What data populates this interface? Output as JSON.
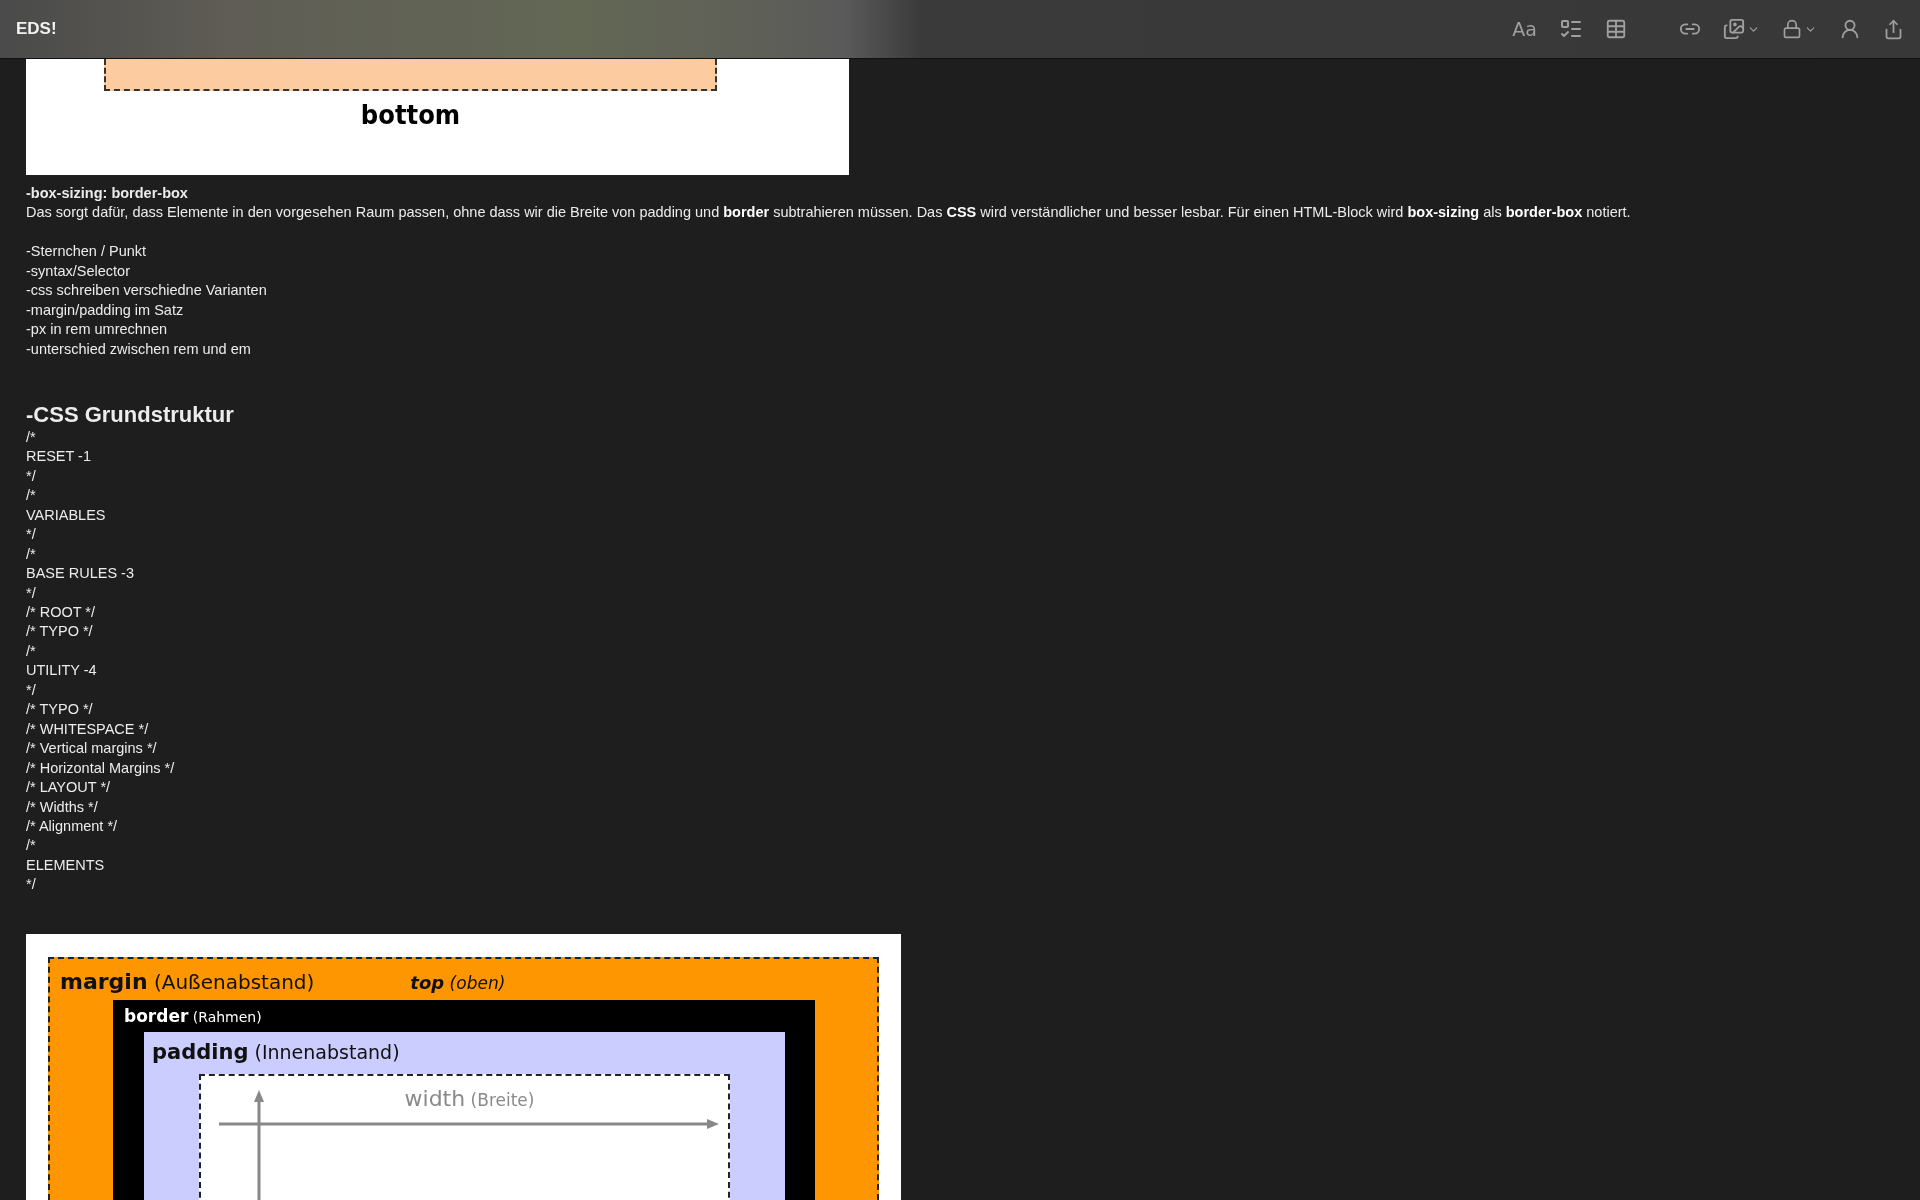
{
  "window": {
    "title": "EDS!"
  },
  "toolbar": {
    "format_label": "Aa"
  },
  "top_figure": {
    "label": "bottom"
  },
  "blocks": [
    {
      "kind": "bold",
      "text": "-box-sizing: border-box"
    },
    {
      "kind": "text",
      "text": "Das sorgt dafür, dass Elemente in den vorgesehen Raum passen, ohne dass wir die Breite von padding und **border** subtrahieren müssen. Das **CSS** wird verständlicher und besser lesbar. Für einen HTML-Block wird **box-sizing** als **border-box** notiert."
    },
    {
      "kind": "blank"
    },
    {
      "kind": "text",
      "text": "-Sternchen / Punkt"
    },
    {
      "kind": "text",
      "text": "-syntax/Selector"
    },
    {
      "kind": "text",
      "text": "-css schreiben verschiedne Varianten"
    },
    {
      "kind": "text",
      "text": "-margin/padding im Satz"
    },
    {
      "kind": "text",
      "text": "-px in rem umrechnen"
    },
    {
      "kind": "text",
      "text": "-unterschied zwischen rem und em"
    },
    {
      "kind": "blank"
    },
    {
      "kind": "blank"
    },
    {
      "kind": "heading",
      "text": "-CSS Grundstruktur"
    },
    {
      "kind": "text",
      "text": "/*"
    },
    {
      "kind": "text",
      "text": "RESET -1"
    },
    {
      "kind": "text",
      "text": "*/"
    },
    {
      "kind": "text",
      "text": "/*"
    },
    {
      "kind": "text",
      "text": "VARIABLES"
    },
    {
      "kind": "text",
      "text": "*/"
    },
    {
      "kind": "text",
      "text": "/*"
    },
    {
      "kind": "text",
      "text": "BASE RULES -3"
    },
    {
      "kind": "text",
      "text": "*/"
    },
    {
      "kind": "text",
      "text": "/* ROOT */"
    },
    {
      "kind": "text",
      "text": "/* TYPO */"
    },
    {
      "kind": "text",
      "text": "/*"
    },
    {
      "kind": "text",
      "text": "UTILITY -4"
    },
    {
      "kind": "text",
      "text": "*/"
    },
    {
      "kind": "text",
      "text": "/* TYPO */"
    },
    {
      "kind": "text",
      "text": "/* WHITESPACE */"
    },
    {
      "kind": "text",
      "text": "/* Vertical margins */"
    },
    {
      "kind": "text",
      "text": "/* Horizontal Margins */"
    },
    {
      "kind": "text",
      "text": "/* LAYOUT */"
    },
    {
      "kind": "text",
      "text": "/* Widths */"
    },
    {
      "kind": "text",
      "text": "/* Alignment */"
    },
    {
      "kind": "text",
      "text": "/*"
    },
    {
      "kind": "text",
      "text": "ELEMENTS"
    },
    {
      "kind": "text",
      "text": "*/"
    },
    {
      "kind": "blank"
    },
    {
      "kind": "blank"
    }
  ],
  "box_model_figure": {
    "margin": {
      "term": "margin",
      "gloss": "(Außenabstand)"
    },
    "top": {
      "term": "top",
      "gloss": "(oben)"
    },
    "border": {
      "term": "border",
      "gloss": "(Rahmen)"
    },
    "padding": {
      "term": "padding",
      "gloss": "(Innenabstand)"
    },
    "width": {
      "term": "width",
      "gloss": "(Breite)"
    }
  }
}
